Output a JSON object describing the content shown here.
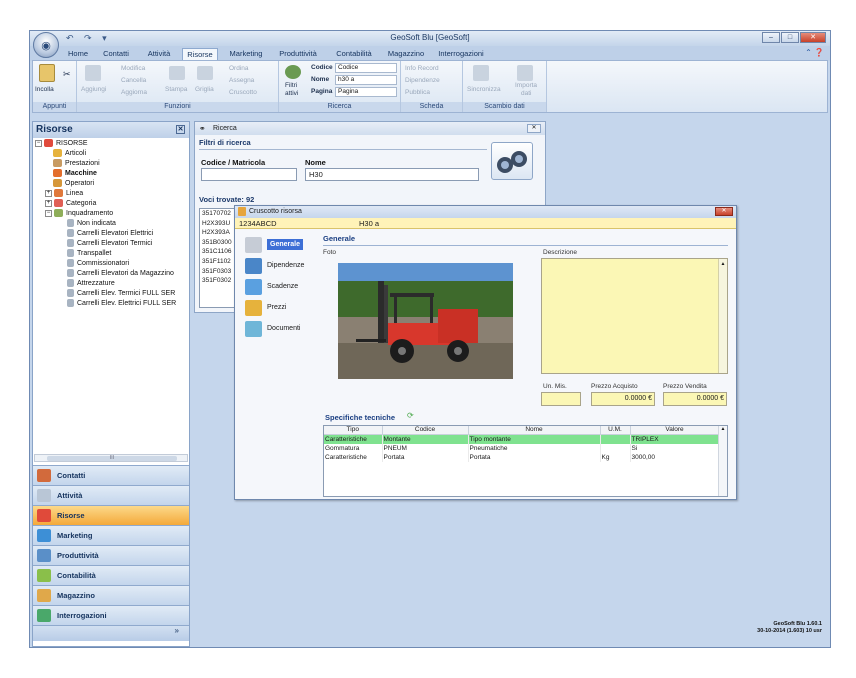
{
  "window": {
    "title": "GeoSoft Blu [GeoSoft]",
    "version_line1": "GeoSoft Blu 1.60.1",
    "version_line2": "30-10-2014 (1.603) 10 usr"
  },
  "tabs": [
    "Home",
    "Contatti",
    "Attività",
    "Risorse",
    "Marketing",
    "Produttività",
    "Contabilità",
    "Magazzino",
    "Interrogazioni"
  ],
  "active_tab": "Risorse",
  "ribbon": {
    "groups": {
      "appunti": "Appunti",
      "funzioni": "Funzioni",
      "ricerca": "Ricerca",
      "scheda": "Scheda",
      "scambio": "Scambio dati"
    },
    "incolla": "Incolla",
    "aggiungi": "Aggiungi",
    "modifica": "Modifica",
    "cancella": "Cancella",
    "aggiorna": "Aggiorna",
    "stampa": "Stampa",
    "griglia": "Griglia",
    "ordina": "Ordina",
    "assegna": "Assegna",
    "cruscotto": "Cruscotto",
    "filtri_attivi_1": "Filtri",
    "filtri_attivi_2": "attivi",
    "codice_label": "Codice",
    "codice_value": "Codice",
    "nome_label": "Nome",
    "nome_value": "h30 a",
    "pagina_label": "Pagina",
    "pagina_value": "Pagina",
    "info_record": "Info Record",
    "dipendenze": "Dipendenze",
    "pubblica": "Pubblica",
    "sincronizza": "Sincronizza",
    "importa_1": "Importa",
    "importa_2": "dati"
  },
  "left_panel": {
    "title": "Risorse",
    "tree": {
      "root": "RISORSE",
      "articoli": "Articoli",
      "prestazioni": "Prestazioni",
      "macchine": "Macchine",
      "operatori": "Operatori",
      "linea": "Linea",
      "categoria": "Categoria",
      "inquadramento": "Inquadramento",
      "children": [
        "Non indicata",
        "Carrelli Elevatori Elettrici",
        "Carrelli Elevatori Termici",
        "Transpallet",
        "Commissionatori",
        "Carrelli Elevatori da Magazzino",
        "Attrezzature",
        "Carrelli Elev. Termici FULL SER",
        "Carrelli Elev. Elettrici FULL SER"
      ]
    },
    "scroll_label": "III",
    "nav": [
      "Contatti",
      "Attività",
      "Risorse",
      "Marketing",
      "Produttività",
      "Contabilità",
      "Magazzino",
      "Interrogazioni"
    ],
    "nav_active": "Risorse"
  },
  "ricerca": {
    "title": "Ricerca",
    "section": "Filtri di ricerca",
    "codice_label": "Codice / Matricola",
    "codice_value": "",
    "nome_label": "Nome",
    "nome_value": "H30",
    "found": "Voci trovate: 92",
    "results": [
      "35170702",
      "H2X393U",
      "H2X393A",
      "351B0300",
      "351C1106",
      "351F1102",
      "351F0303",
      "351F0302"
    ]
  },
  "cruscotto": {
    "title": "Cruscotto risorsa",
    "code": "1234ABCD",
    "name": "H30 a",
    "side": [
      "Generale",
      "Dipendenze",
      "Scadenze",
      "Prezzi",
      "Documenti"
    ],
    "section": "Generale",
    "foto_label": "Foto",
    "descrizione_label": "Descrizione",
    "un_mis_label": "Un. Mis.",
    "un_mis_value": "",
    "prezzo_acquisto_label": "Prezzo Acquisto",
    "prezzo_acquisto_value": "0.0000 €",
    "prezzo_vendita_label": "Prezzo Vendita",
    "prezzo_vendita_value": "0.0000 €",
    "specifiche_title": "Specifiche tecniche",
    "grid_headers": [
      "Tipo",
      "Codice",
      "Nome",
      "U.M.",
      "Valore"
    ],
    "grid_rows": [
      [
        "Caratteristiche",
        "Montante",
        "Tipo montante",
        "",
        "TRIPLEX"
      ],
      [
        "Gommatura",
        "PNEUM",
        "Pneumatiche",
        "",
        "Si"
      ],
      [
        "Caratteristiche",
        "Portata",
        "Portata",
        "Kg",
        "3000,00"
      ]
    ]
  },
  "colors": {
    "accent": "#3d6fd6",
    "nav_active": "#f4a93a",
    "selected_row": "#7fe28f",
    "yellow_field": "#fbf7b5"
  }
}
